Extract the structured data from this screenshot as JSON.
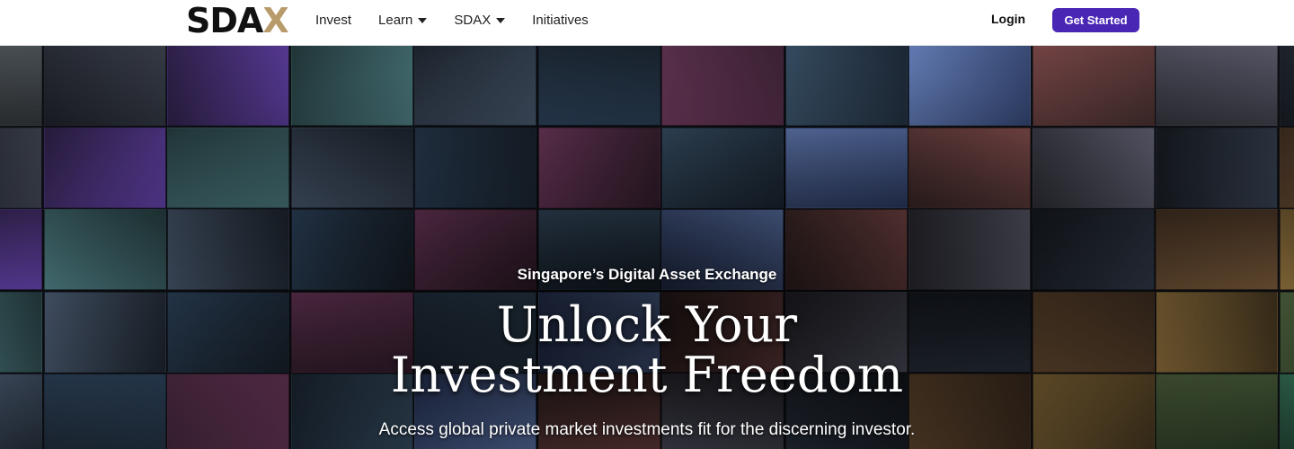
{
  "brand": {
    "logo_text_prefix": "SDA",
    "logo_text_accent": "X",
    "accent_color": "#b89b6a",
    "cta_color": "#4a26b5"
  },
  "nav": {
    "items": [
      {
        "label": "Invest",
        "dropdown": false
      },
      {
        "label": "Learn",
        "dropdown": true
      },
      {
        "label": "SDAX",
        "dropdown": true
      },
      {
        "label": "Initiatives",
        "dropdown": false
      }
    ],
    "login_label": "Login",
    "cta_label": "Get Started"
  },
  "hero": {
    "tagline": "Singapore’s Digital Asset Exchange",
    "headline_line1": "Unlock Your",
    "headline_line2": "Investment Freedom",
    "subline": "Access global private market investments fit for the discerning investor."
  }
}
